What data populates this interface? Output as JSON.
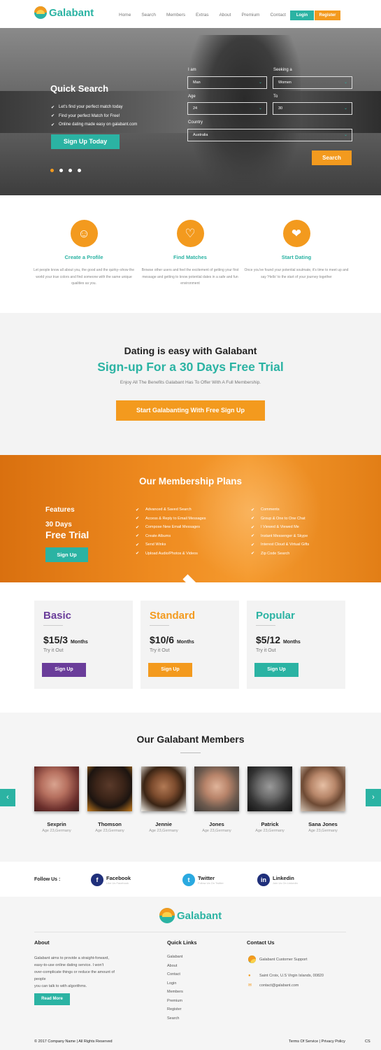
{
  "header": {
    "brand": "Galabant",
    "nav": [
      "Home",
      "Search",
      "Members",
      "Extras",
      "About",
      "Premium",
      "Contact"
    ],
    "login": "Login",
    "register": "Register"
  },
  "hero": {
    "title": "Quick Search",
    "bullets": [
      "Let's find your perfect match today",
      "Find your perfect Match for Free!",
      "Online dating made easy on galabant.com"
    ],
    "cta": "Sign Up Today",
    "form": {
      "i_am_label": "I am",
      "i_am_value": "Man",
      "seeking_label": "Seeking a",
      "seeking_value": "Women",
      "age_label": "Age",
      "age_value": "24",
      "to_label": "To",
      "to_value": "30",
      "country_label": "Country",
      "country_value": "Australia",
      "search": "Search"
    }
  },
  "features": [
    {
      "title": "Create a Profile",
      "text": "Let people know all about you, the good and the quirky–show the world your true colors and find someone with the same unique qualities as you."
    },
    {
      "title": "Find Matches",
      "text": "Browse other users and feel the excitement of getting your first message and getting to know potential dates in a safe and fun environment"
    },
    {
      "title": "Start Dating",
      "text": "Once you've found your potential soulmate, it's time to meet up and say 'Hello' to the start of your journey together"
    }
  ],
  "trial": {
    "heading": "Dating is easy with Galabant",
    "subheading": "Sign-up For a 30 Days Free Trial",
    "text": "Enjoy All The Benefits Galabant Has To Offer With A Full Membership.",
    "cta": "Start Galabanting With Free Sign Up"
  },
  "plans": {
    "title": "Our Membership Plans",
    "features_label": "Features",
    "days": "30 Days",
    "free_trial": "Free Trial",
    "cta": "Sign Up",
    "col1": [
      "Advanced & Saved Search",
      "Access & Reply to Email Messages",
      "Compose New Email Messages",
      "Create Albums",
      "Send Winks",
      "Upload Audio/Photos & Videos"
    ],
    "col2": [
      "Comments",
      "Group & One to One Chat",
      "I Viewed & Viewed Me",
      "Instant Messenger & Skype",
      "Interest Cloud & Virtual Gifts",
      "Zip Code Search"
    ]
  },
  "pricing": [
    {
      "name": "Basic",
      "price": "$15/3",
      "unit": "Months",
      "sub": "Try it Out",
      "cta": "Sign Up",
      "color": "#6a3d9a"
    },
    {
      "name": "Standard",
      "price": "$10/6",
      "unit": "Months",
      "sub": "Try it Out",
      "cta": "Sign Up",
      "color": "#f39a1e"
    },
    {
      "name": "Popular",
      "price": "$5/12",
      "unit": "Months",
      "sub": "Try it Out",
      "cta": "Sign Up",
      "color": "#2bb3a3"
    }
  ],
  "members": {
    "title": "Our Galabant Members",
    "list": [
      {
        "name": "Sexprin",
        "info": "Age 23,Germany"
      },
      {
        "name": "Thomson",
        "info": "Age 23,Germany"
      },
      {
        "name": "Jennie",
        "info": "Age 23,Germany"
      },
      {
        "name": "Jones",
        "info": "Age 23,Germany"
      },
      {
        "name": "Patrick",
        "info": "Age 23,Germany"
      },
      {
        "name": "Sana Jones",
        "info": "Age 23,Germany"
      }
    ]
  },
  "follow": {
    "label": "Follow Us :",
    "facebook": "Facebook",
    "facebook_sub": "Like Us Facebook",
    "twitter": "Twitter",
    "twitter_sub": "Follow Us On Twitter",
    "linkedin": "Linkedin",
    "linkedin_sub": "Join Us On Linkedin"
  },
  "footer": {
    "brand": "Galabant",
    "about_title": "About",
    "about_text": [
      "Galabant aims to provide a straight-forward,",
      "easy-to-use online dating  service. I won't",
      "over-complicate things or reduce the amount of people",
      "you can talk to with algorithms."
    ],
    "read_more": "Read More",
    "links_title": "Quick Links",
    "links": [
      "Galabant",
      "About",
      "Contact",
      "Login",
      "Members",
      "Premium",
      "Register",
      "Search"
    ],
    "contact_title": "Contact Us",
    "support": "Galabant Customer Support",
    "address": "Saint Croix, U.S Virgin Islands, 00820",
    "email": "contact@galabant.com",
    "copyright": "© 2017 Company Name | All Rights Reserved",
    "terms": "Terms Of Service | Privacy Policy",
    "cs": "CS"
  }
}
